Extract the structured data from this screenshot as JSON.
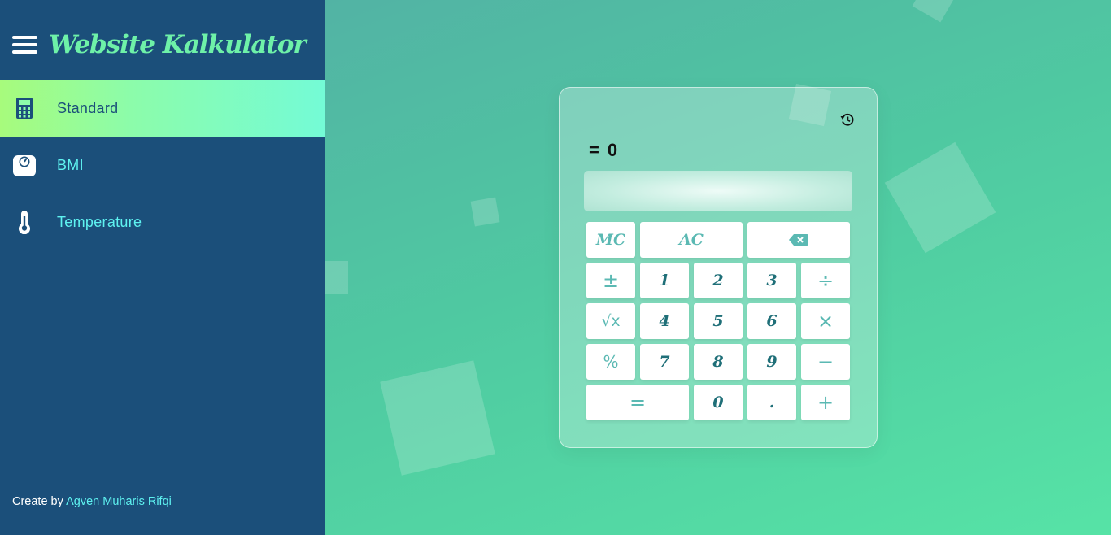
{
  "app": {
    "title": "Website Kalkulator"
  },
  "sidebar": {
    "items": [
      {
        "label": "Standard",
        "icon": "calculator-icon",
        "active": true
      },
      {
        "label": "BMI",
        "icon": "scale-icon",
        "active": false
      },
      {
        "label": "Temperature",
        "icon": "thermometer-icon",
        "active": false
      }
    ],
    "footer_prefix": "Create by",
    "footer_author": "Agven Muharis Rifqi"
  },
  "calculator": {
    "result_equals": "=",
    "result_value": "0",
    "display_value": "",
    "history_icon": "history-icon",
    "keys": {
      "mc": "MC",
      "ac": "AC",
      "backspace": "backspace-icon",
      "plusminus": "±",
      "one": "1",
      "two": "2",
      "three": "3",
      "divide": "÷",
      "sqrt": "√x",
      "four": "4",
      "five": "5",
      "six": "6",
      "multiply": "×",
      "percent": "%",
      "seven": "7",
      "eight": "8",
      "nine": "9",
      "minus": "−",
      "equals": "=",
      "zero": "0",
      "dot": ".",
      "plus": "+"
    }
  },
  "colors": {
    "sidebar_bg": "#1b4f7a",
    "brand": "#6ef1a8",
    "nav_text": "#5ef2f0",
    "active_gradient_start": "#a7fb7c",
    "active_gradient_end": "#74fbd6",
    "main_bg_start": "#52b3a4",
    "main_bg_end": "#56e3a6",
    "key_text": "#1f6f78",
    "key_fn_text": "#5bb9b3"
  }
}
